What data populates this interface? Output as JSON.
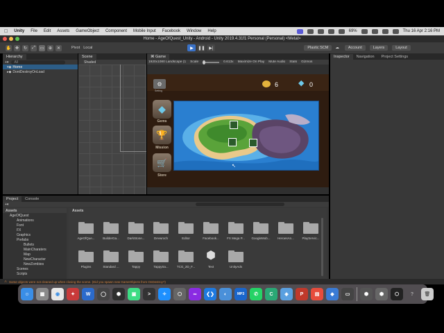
{
  "menubar": {
    "app": "Unity",
    "items": [
      "File",
      "Edit",
      "Assets",
      "GameObject",
      "Component",
      "Mobile Input",
      "Facebook",
      "Window",
      "Help"
    ],
    "battery": "69%",
    "datetime": "Thu 16 Apr  2:16 PM"
  },
  "window": {
    "title": "Home - AgeOfQuest_Unity - Android - Unity 2019.4.31f1 Personal (Personal) <Metal>"
  },
  "toolbar": {
    "pivot": "Pivot",
    "local": "Local",
    "plastic": "Plastic SCM",
    "account": "Account",
    "layers": "Layers",
    "layout": "Layout"
  },
  "hierarchy": {
    "tab": "Hierarchy",
    "search_placeholder": "All",
    "rows": [
      "Home",
      "DontDestroyOnLoad"
    ]
  },
  "scene": {
    "tab": "Scene",
    "shading": "Shaded"
  },
  "game": {
    "tab": "Game",
    "resolution": "1920x1080 Landscape (1",
    "scale_label": "Scale",
    "scale_value": "0.613x",
    "options": [
      "Maximize On Play",
      "Mute Audio",
      "Stats",
      "Gizmos"
    ],
    "coins": "6",
    "gems": "0",
    "setting_label": "Setting",
    "buttons": [
      "Gems",
      "Mission",
      "Store"
    ]
  },
  "inspector": {
    "tabs": [
      "Inspector",
      "Navigation",
      "Project Settings"
    ]
  },
  "project": {
    "tabs": [
      "Project",
      "Console"
    ],
    "tree": [
      "Assets",
      "AgeOfQuest",
      "Animations",
      "Font",
      "FX",
      "Graphics",
      "Prefabs",
      "Bullets",
      "MainCharaters",
      "Map",
      "NewCharacter",
      "NewZombies",
      "Scenes",
      "Scripts"
    ],
    "breadcrumb": "Assets",
    "folders_row1": [
      "AgeOfQue...",
      "BuilderGa...",
      "DarkStone...",
      "Devwroch",
      "Editor",
      "Facebook...",
      "FX Mega P...",
      "GoogleMob...",
      "HeroesAn...",
      "PlayServic..."
    ],
    "folders_row2": [
      "Plugins",
      "Standard ...",
      "Tappy",
      "TappySa...",
      "TCG_2D_F...",
      "Text",
      "UnityAds"
    ]
  },
  "error_text": "Some objects were not cleaned up when closing the scene. (Did you spawn new GameObjects from OnDestroy?)",
  "colors": {
    "accent": "#3a72c8",
    "ocean": "#2a7fd0",
    "panel": "#383838"
  }
}
